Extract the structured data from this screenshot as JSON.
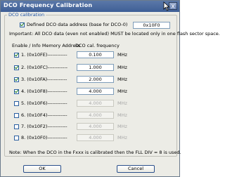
{
  "window": {
    "title": "DCO Frequency Calibration",
    "close_label": "X"
  },
  "group": {
    "label": "DCO calibration"
  },
  "address": {
    "label": "Defined DCO data address (base for DCO-0)",
    "value": "0x10F0",
    "checked": true
  },
  "important": "Important: All DCO data (even not enabled) MUST be located only in one flash sector space.",
  "headers": {
    "enable": "Enable / Info Memory Address",
    "freq": "DCO cal. frequency"
  },
  "rows": [
    {
      "label": "1. (0x10FE)------------",
      "value": "0.100",
      "unit": "MHz",
      "checked": true
    },
    {
      "label": "2. (0x10FC)------------",
      "value": "1.000",
      "unit": "MHz",
      "checked": true
    },
    {
      "label": "3. (0x10FA)------------",
      "value": "2.000",
      "unit": "MHz",
      "checked": true
    },
    {
      "label": "4. (0x10F8)------------",
      "value": "4.000",
      "unit": "MHz",
      "checked": true
    },
    {
      "label": "5. (0x10F6)------------",
      "value": "4.000",
      "unit": "MHz",
      "checked": false
    },
    {
      "label": "6. (0x10F4)------------",
      "value": "4.000",
      "unit": "MHz",
      "checked": false
    },
    {
      "label": "7. (0x10F2)------------",
      "value": "4.000",
      "unit": "MHz",
      "checked": false
    },
    {
      "label": "8. (0x10F0)------------",
      "value": "4.000",
      "unit": "MHz",
      "checked": false
    }
  ],
  "note": "Note: When the DCO in the Fxxx is calibrated then the FLL DIV = 8 is used.",
  "buttons": {
    "ok": "OK",
    "cancel": "Cancel"
  }
}
